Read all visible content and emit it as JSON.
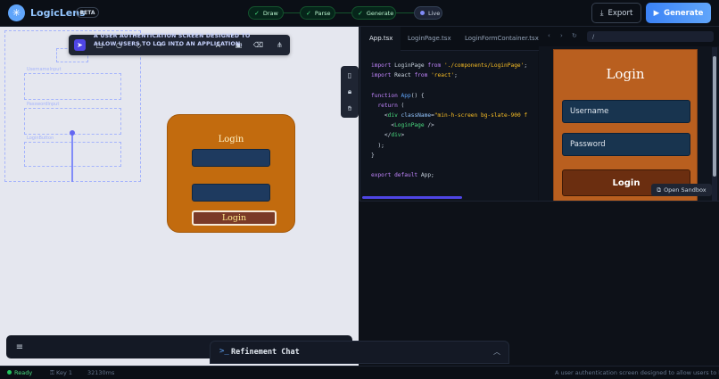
{
  "app": {
    "name": "LogicLens",
    "badge": "BETA"
  },
  "steps": [
    {
      "label": "Draw",
      "state": "done"
    },
    {
      "label": "Parse",
      "state": "done"
    },
    {
      "label": "Generate",
      "state": "done"
    },
    {
      "label": "Live",
      "state": "active"
    }
  ],
  "actions": {
    "export": "Export",
    "generate": "Generate"
  },
  "canvas": {
    "tooltip": "A USER AUTHENTICATION SCREEN DESIGNED TO ALLOW USERS TO LOG INTO AN APPLICATION.",
    "sketch": {
      "title": "Login",
      "button": "Login"
    },
    "toolbar_icons": [
      "cursor-icon",
      "square-icon",
      "circle-icon",
      "diamond-icon",
      "arrow-icon",
      "line-icon",
      "text-icon",
      "image-icon",
      "eraser-icon",
      "share-icon"
    ],
    "side_icons": [
      "book-icon",
      "lock-icon",
      "hand-icon"
    ]
  },
  "editor": {
    "tabs": [
      "App.tsx",
      "LoginPage.tsx",
      "LoginFormContainer.tsx"
    ],
    "active_tab": "App.tsx",
    "code": {
      "l1_kw": "import",
      "l1_name": " LoginPage ",
      "l1_from": "from",
      "l1_str": " './components/LoginPage'",
      "l1_end": ";",
      "l2_kw": "import",
      "l2_name": " React ",
      "l2_from": "from",
      "l2_str": " 'react'",
      "l2_end": ";",
      "l4_kw": "function",
      "l4_fn": " App",
      "l4_end": "() {",
      "l5_kw": "  return",
      "l5_end": " (",
      "l6_pre": "    <",
      "l6_tag": "div",
      "l6_attr": " className",
      "l6_eq": "=",
      "l6_str": "\"min-h-screen bg-slate-900 f",
      "l7_pre": "      <",
      "l7_tag": "LoginPage",
      "l7_end": " />",
      "l8_pre": "    </",
      "l8_tag": "div",
      "l8_end": ">",
      "l9": "  );",
      "l10": "}",
      "l12_kw": "export default",
      "l12_end": " App;"
    }
  },
  "preview": {
    "url": "/",
    "title": "Login",
    "username_placeholder": "Username",
    "password_placeholder": "Password",
    "button": "Login",
    "sandbox": "Open Sandbox"
  },
  "chat": {
    "title": "Refinement Chat"
  },
  "status": {
    "ready": "Ready",
    "key": "Key 1",
    "time": "32130ms",
    "description": "A user authentication screen designed to allow users to lo..."
  }
}
